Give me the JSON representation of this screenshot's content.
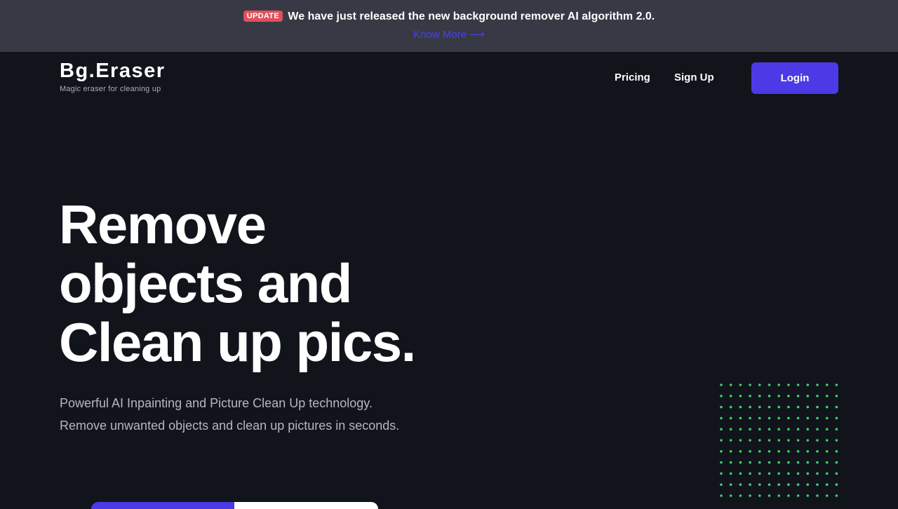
{
  "banner": {
    "badge": "UPDATE",
    "message": "We have just released the new background remover AI algorithm 2.0.",
    "link": "Know More ⟶"
  },
  "header": {
    "logo_title": "Bg.Eraser",
    "logo_tagline": "Magic eraser for cleaning up",
    "nav": {
      "pricing": "Pricing",
      "signup": "Sign Up",
      "login": "Login"
    }
  },
  "hero": {
    "title_lines": [
      "Remove",
      "objects and",
      "Clean up pics."
    ],
    "subtitle": "Powerful AI Inpainting and Picture Clean Up technology. Remove unwanted objects and clean up pictures in seconds."
  },
  "colors": {
    "background": "#12141c",
    "banner": "#373a45",
    "accent": "#4b3ae6",
    "badge": "#e0505a",
    "dots": "#3ecf6e"
  },
  "decor": {
    "dot_pattern_icon": "dot-grid-pattern"
  }
}
